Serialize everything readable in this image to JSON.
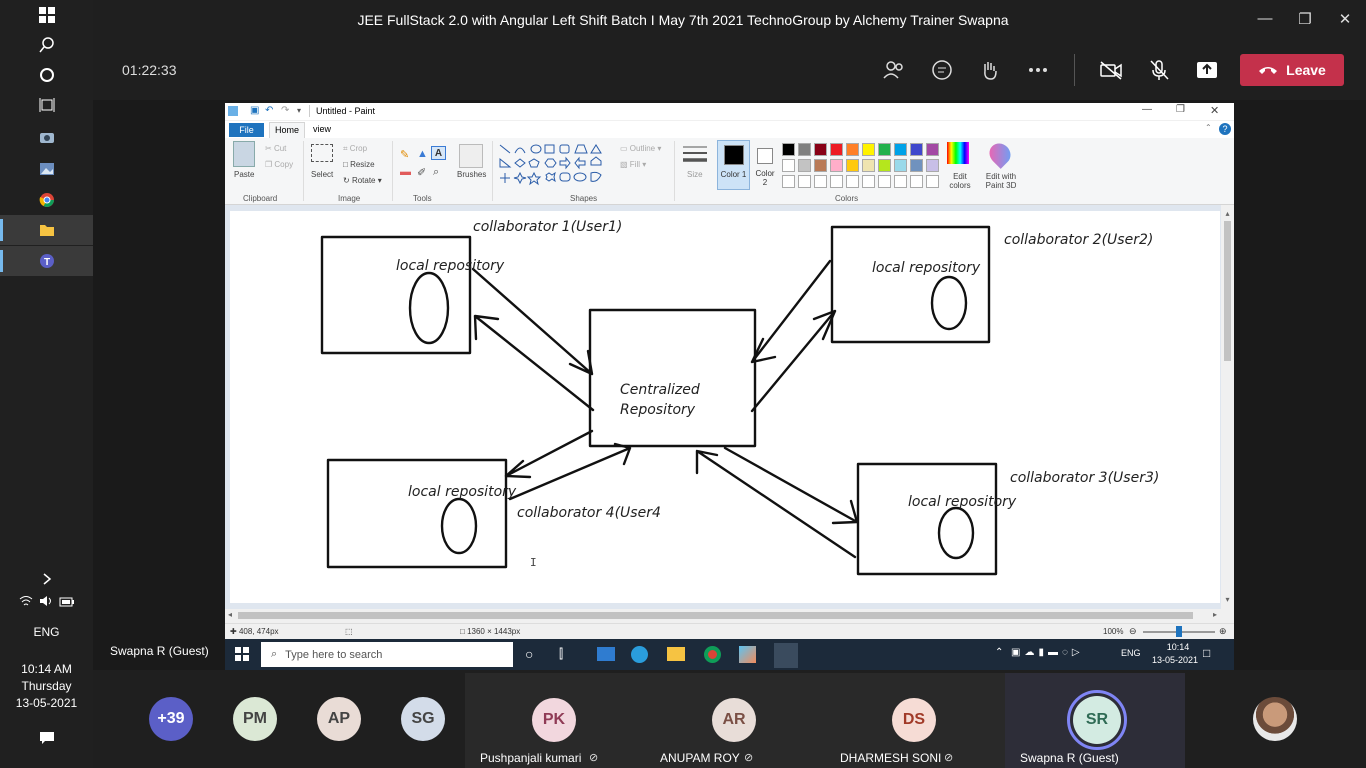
{
  "window": {
    "title": "JEE FullStack 2.0 with Angular Left Shift Batch I May 7th 2021 TechnoGroup by Alchemy Trainer Swapna"
  },
  "toolbar": {
    "timer": "01:22:33",
    "leave_label": "Leave",
    "icons": [
      "people-icon",
      "chat-icon",
      "raise-hand-icon",
      "more-icon",
      "camera-off-icon",
      "mic-off-icon",
      "share-icon"
    ]
  },
  "os_taskbar": {
    "language": "ENG",
    "time": "10:14 AM",
    "day": "Thursday",
    "date": "13-05-2021"
  },
  "presenter": "Swapna R (Guest)",
  "paint": {
    "title": "Untitled - Paint",
    "tabs": [
      "File",
      "Home",
      "view"
    ],
    "groups": [
      "Clipboard",
      "Image",
      "Tools",
      "Shapes",
      "Colors"
    ],
    "clipboard": {
      "paste": "Paste",
      "cut": "Cut",
      "copy": "Copy"
    },
    "image": {
      "select": "Select",
      "crop": "Crop",
      "resize": "Resize",
      "rotate": "Rotate"
    },
    "brushes": "Brushes",
    "outline": "Outline",
    "fill": "Fill",
    "size": "Size",
    "color1": "Color 1",
    "color2": "Color 2",
    "edit_colors": "Edit colors",
    "edit_paint3d": "Edit with Paint 3D",
    "palette": [
      "#000000",
      "#7f7f7f",
      "#880015",
      "#ed1c24",
      "#ff7f27",
      "#fff200",
      "#22b14c",
      "#00a2e8",
      "#3f48cc",
      "#a349a4",
      "#ffffff",
      "#c3c3c3",
      "#b97a57",
      "#ffaec9",
      "#ffc90e",
      "#efe4b0",
      "#b5e61d",
      "#99d9ea",
      "#7092be",
      "#c8bfe7"
    ],
    "status": {
      "cursor": "408, 474px",
      "dimensions": "1360 × 1443px",
      "zoom": "100%"
    },
    "diagram": {
      "center": "Centralized",
      "center2": "Repository",
      "local": "local repository",
      "c1": "collaborator 1(User1)",
      "c2": "collaborator 2(User2)",
      "c3": "collaborator 3(User3)",
      "c4": "collaborator 4(User4"
    },
    "remote_taskbar": {
      "search_placeholder": "Type here to search",
      "lang": "ENG",
      "time": "10:14",
      "date": "13-05-2021"
    }
  },
  "participants": {
    "overflow": "+39",
    "small": [
      {
        "initials": "PM",
        "color": "#dbe8d5"
      },
      {
        "initials": "AP",
        "color": "#e9dcd6"
      },
      {
        "initials": "SG",
        "color": "#d3dce9"
      }
    ],
    "tiles": [
      {
        "initials": "PK",
        "name": "Pushpanjali kumari",
        "color": "#f2d7de",
        "text": "#8f3a55"
      },
      {
        "initials": "AR",
        "name": "ANUPAM ROY",
        "color": "#e8ddd8",
        "text": "#7a4f45"
      },
      {
        "initials": "DS",
        "name": "DHARMESH SONI",
        "color": "#f6dcd5",
        "text": "#a13a28"
      },
      {
        "initials": "SR",
        "name": "Swapna R (Guest)",
        "color": "#d3ebe2",
        "text": "#2f6b55"
      }
    ]
  }
}
